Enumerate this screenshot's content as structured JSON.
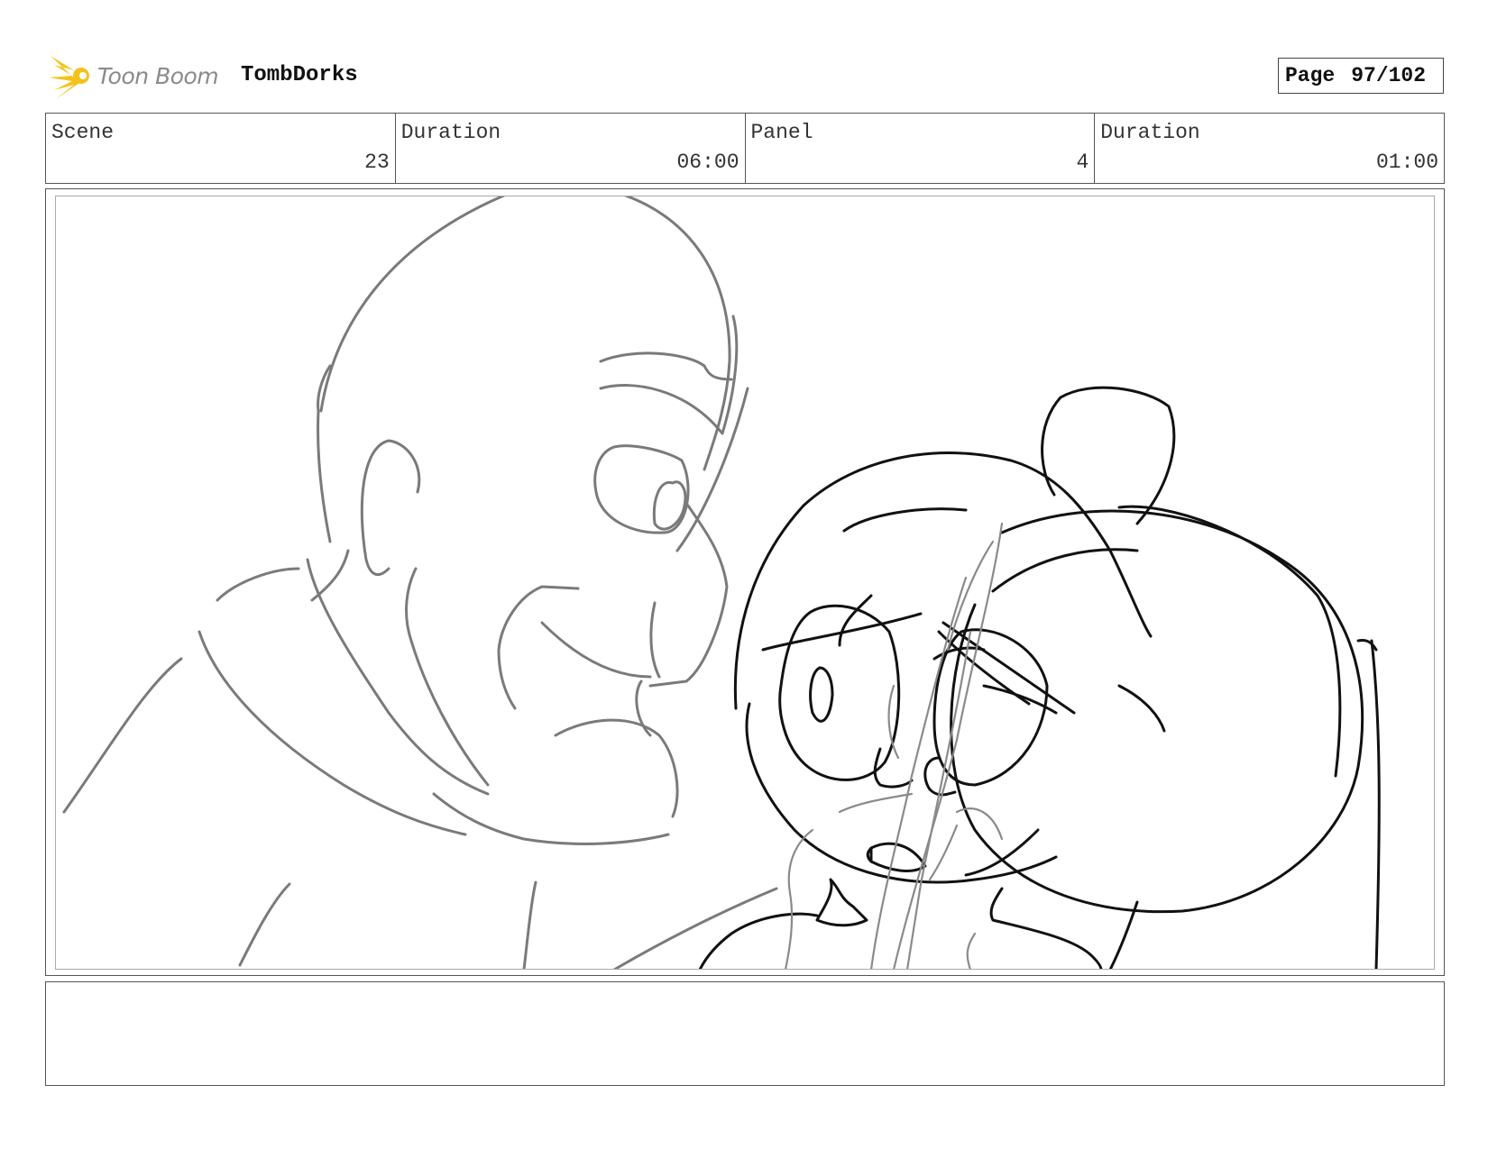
{
  "header": {
    "brand_name": "Toon Boom",
    "project_title": "TombDorks",
    "page_label": "Page",
    "page_number": "97/102"
  },
  "info": {
    "scene_label": "Scene",
    "scene_value": "23",
    "duration_label": "Duration",
    "duration_value": "06:00",
    "panel_label": "Panel",
    "panel_value": "4",
    "panel_duration_label": "Duration",
    "panel_duration_value": "01:00"
  },
  "panel_image": {
    "description_icon": "storyboard-sketch"
  },
  "notes": {
    "text": ""
  },
  "colors": {
    "brand_logo": "#f5c21b",
    "sketch_grey": "#7a7a7a",
    "sketch_black": "#111111"
  }
}
